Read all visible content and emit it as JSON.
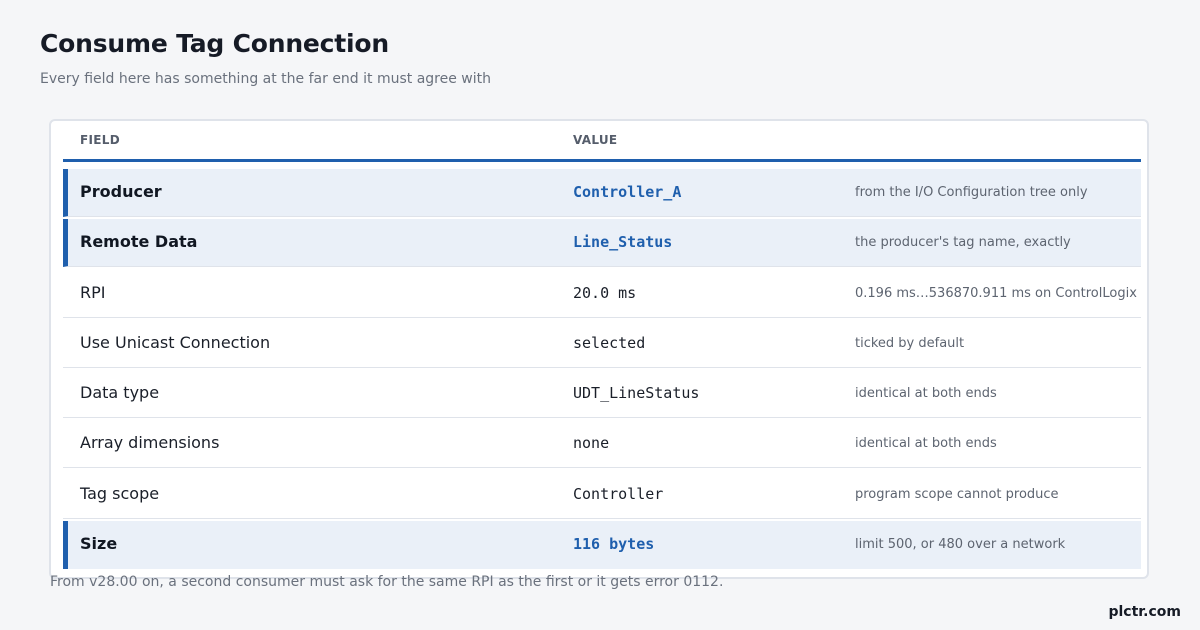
{
  "header": {
    "title": "Consume Tag Connection",
    "subtitle": "Every field here has something at the far end it must agree with"
  },
  "table": {
    "columns": {
      "field": "FIELD",
      "value": "VALUE"
    },
    "rows": [
      {
        "field": "Producer",
        "value": "Controller_A",
        "note": "from the I/O Configuration tree only",
        "highlight": true
      },
      {
        "field": "Remote Data",
        "value": "Line_Status",
        "note": "the producer's tag name, exactly",
        "highlight": true
      },
      {
        "field": "RPI",
        "value": "20.0 ms",
        "note": "0.196 ms…536870.911 ms on ControlLogix",
        "highlight": false
      },
      {
        "field": "Use Unicast Connection",
        "value": "selected",
        "note": "ticked by default",
        "highlight": false
      },
      {
        "field": "Data type",
        "value": "UDT_LineStatus",
        "note": "identical at both ends",
        "highlight": false
      },
      {
        "field": "Array dimensions",
        "value": "none",
        "note": "identical at both ends",
        "highlight": false
      },
      {
        "field": "Tag scope",
        "value": "Controller",
        "note": "program scope cannot produce",
        "highlight": false
      },
      {
        "field": "Size",
        "value": "116 bytes",
        "note": "limit 500, or 480 over a network",
        "highlight": true
      }
    ]
  },
  "footnote": "From v28.00 on, a second consumer must ask for the same RPI as the first or it gets error 0112.",
  "brand": "plctr.com",
  "colors": {
    "accent": "#1f5fad",
    "highlight_row": "#eaf0f8",
    "background": "#f5f6f8"
  }
}
